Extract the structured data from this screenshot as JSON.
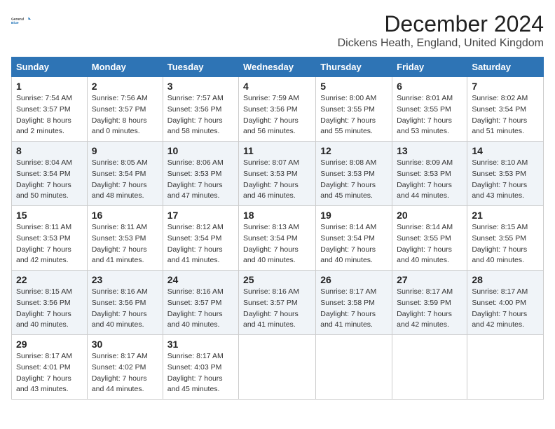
{
  "logo": {
    "line1": "General",
    "line2": "Blue"
  },
  "title": "December 2024",
  "location": "Dickens Heath, England, United Kingdom",
  "days_of_week": [
    "Sunday",
    "Monday",
    "Tuesday",
    "Wednesday",
    "Thursday",
    "Friday",
    "Saturday"
  ],
  "weeks": [
    [
      {
        "day": "1",
        "sunrise": "7:54 AM",
        "sunset": "3:57 PM",
        "daylight": "8 hours and 2 minutes."
      },
      {
        "day": "2",
        "sunrise": "7:56 AM",
        "sunset": "3:57 PM",
        "daylight": "8 hours and 0 minutes."
      },
      {
        "day": "3",
        "sunrise": "7:57 AM",
        "sunset": "3:56 PM",
        "daylight": "7 hours and 58 minutes."
      },
      {
        "day": "4",
        "sunrise": "7:59 AM",
        "sunset": "3:56 PM",
        "daylight": "7 hours and 56 minutes."
      },
      {
        "day": "5",
        "sunrise": "8:00 AM",
        "sunset": "3:55 PM",
        "daylight": "7 hours and 55 minutes."
      },
      {
        "day": "6",
        "sunrise": "8:01 AM",
        "sunset": "3:55 PM",
        "daylight": "7 hours and 53 minutes."
      },
      {
        "day": "7",
        "sunrise": "8:02 AM",
        "sunset": "3:54 PM",
        "daylight": "7 hours and 51 minutes."
      }
    ],
    [
      {
        "day": "8",
        "sunrise": "8:04 AM",
        "sunset": "3:54 PM",
        "daylight": "7 hours and 50 minutes."
      },
      {
        "day": "9",
        "sunrise": "8:05 AM",
        "sunset": "3:54 PM",
        "daylight": "7 hours and 48 minutes."
      },
      {
        "day": "10",
        "sunrise": "8:06 AM",
        "sunset": "3:53 PM",
        "daylight": "7 hours and 47 minutes."
      },
      {
        "day": "11",
        "sunrise": "8:07 AM",
        "sunset": "3:53 PM",
        "daylight": "7 hours and 46 minutes."
      },
      {
        "day": "12",
        "sunrise": "8:08 AM",
        "sunset": "3:53 PM",
        "daylight": "7 hours and 45 minutes."
      },
      {
        "day": "13",
        "sunrise": "8:09 AM",
        "sunset": "3:53 PM",
        "daylight": "7 hours and 44 minutes."
      },
      {
        "day": "14",
        "sunrise": "8:10 AM",
        "sunset": "3:53 PM",
        "daylight": "7 hours and 43 minutes."
      }
    ],
    [
      {
        "day": "15",
        "sunrise": "8:11 AM",
        "sunset": "3:53 PM",
        "daylight": "7 hours and 42 minutes."
      },
      {
        "day": "16",
        "sunrise": "8:11 AM",
        "sunset": "3:53 PM",
        "daylight": "7 hours and 41 minutes."
      },
      {
        "day": "17",
        "sunrise": "8:12 AM",
        "sunset": "3:54 PM",
        "daylight": "7 hours and 41 minutes."
      },
      {
        "day": "18",
        "sunrise": "8:13 AM",
        "sunset": "3:54 PM",
        "daylight": "7 hours and 40 minutes."
      },
      {
        "day": "19",
        "sunrise": "8:14 AM",
        "sunset": "3:54 PM",
        "daylight": "7 hours and 40 minutes."
      },
      {
        "day": "20",
        "sunrise": "8:14 AM",
        "sunset": "3:55 PM",
        "daylight": "7 hours and 40 minutes."
      },
      {
        "day": "21",
        "sunrise": "8:15 AM",
        "sunset": "3:55 PM",
        "daylight": "7 hours and 40 minutes."
      }
    ],
    [
      {
        "day": "22",
        "sunrise": "8:15 AM",
        "sunset": "3:56 PM",
        "daylight": "7 hours and 40 minutes."
      },
      {
        "day": "23",
        "sunrise": "8:16 AM",
        "sunset": "3:56 PM",
        "daylight": "7 hours and 40 minutes."
      },
      {
        "day": "24",
        "sunrise": "8:16 AM",
        "sunset": "3:57 PM",
        "daylight": "7 hours and 40 minutes."
      },
      {
        "day": "25",
        "sunrise": "8:16 AM",
        "sunset": "3:57 PM",
        "daylight": "7 hours and 41 minutes."
      },
      {
        "day": "26",
        "sunrise": "8:17 AM",
        "sunset": "3:58 PM",
        "daylight": "7 hours and 41 minutes."
      },
      {
        "day": "27",
        "sunrise": "8:17 AM",
        "sunset": "3:59 PM",
        "daylight": "7 hours and 42 minutes."
      },
      {
        "day": "28",
        "sunrise": "8:17 AM",
        "sunset": "4:00 PM",
        "daylight": "7 hours and 42 minutes."
      }
    ],
    [
      {
        "day": "29",
        "sunrise": "8:17 AM",
        "sunset": "4:01 PM",
        "daylight": "7 hours and 43 minutes."
      },
      {
        "day": "30",
        "sunrise": "8:17 AM",
        "sunset": "4:02 PM",
        "daylight": "7 hours and 44 minutes."
      },
      {
        "day": "31",
        "sunrise": "8:17 AM",
        "sunset": "4:03 PM",
        "daylight": "7 hours and 45 minutes."
      },
      null,
      null,
      null,
      null
    ]
  ],
  "labels": {
    "sunrise": "Sunrise: ",
    "sunset": "Sunset: ",
    "daylight": "Daylight: "
  }
}
